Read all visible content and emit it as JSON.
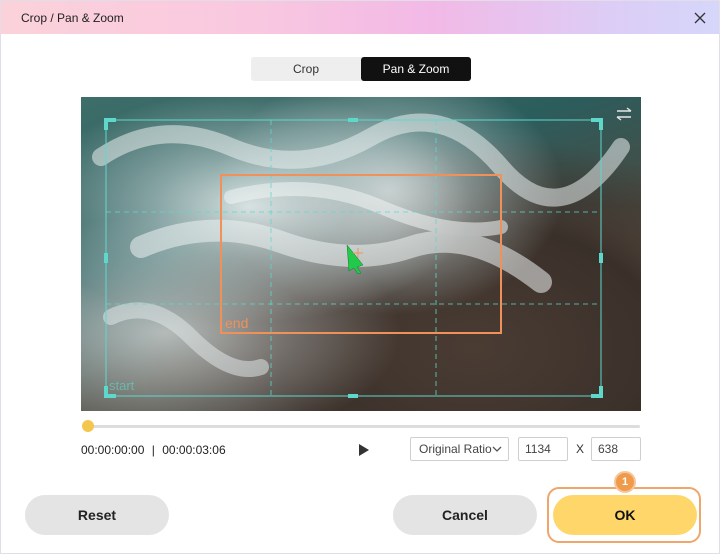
{
  "window": {
    "title": "Crop / Pan & Zoom",
    "icons": {
      "close": "close-icon"
    }
  },
  "tabs": [
    {
      "label": "Crop",
      "active": false
    },
    {
      "label": "Pan & Zoom",
      "active": true
    }
  ],
  "preview": {
    "end_label": "end",
    "start_label": "start",
    "icons": {
      "swap": "swap-arrows-icon",
      "cursor": "pointer-cursor-icon"
    },
    "colors": {
      "crop_frame": "#5fd8cc",
      "end_frame": "#f0915a",
      "start_label": "#5fd8cc",
      "cursor": "#22c94a"
    }
  },
  "playback": {
    "position": 0.0,
    "current_time": "00:00:00:00",
    "separator": "|",
    "total_time": "00:00:03:06",
    "icons": {
      "play": "play-icon"
    }
  },
  "ratio": {
    "selected": "Original Ratio",
    "icons": {
      "dropdown": "chevron-down-icon"
    }
  },
  "dimensions": {
    "width": "1134",
    "separator": "X",
    "height": "638"
  },
  "buttons": {
    "reset": "Reset",
    "cancel": "Cancel",
    "ok": "OK"
  },
  "callout": {
    "step": "1",
    "color": "#f09a4b"
  },
  "colors": {
    "accent": "#fed66a",
    "titlebar_start": "#fbd2da",
    "titlebar_end": "#d6d6fa"
  }
}
